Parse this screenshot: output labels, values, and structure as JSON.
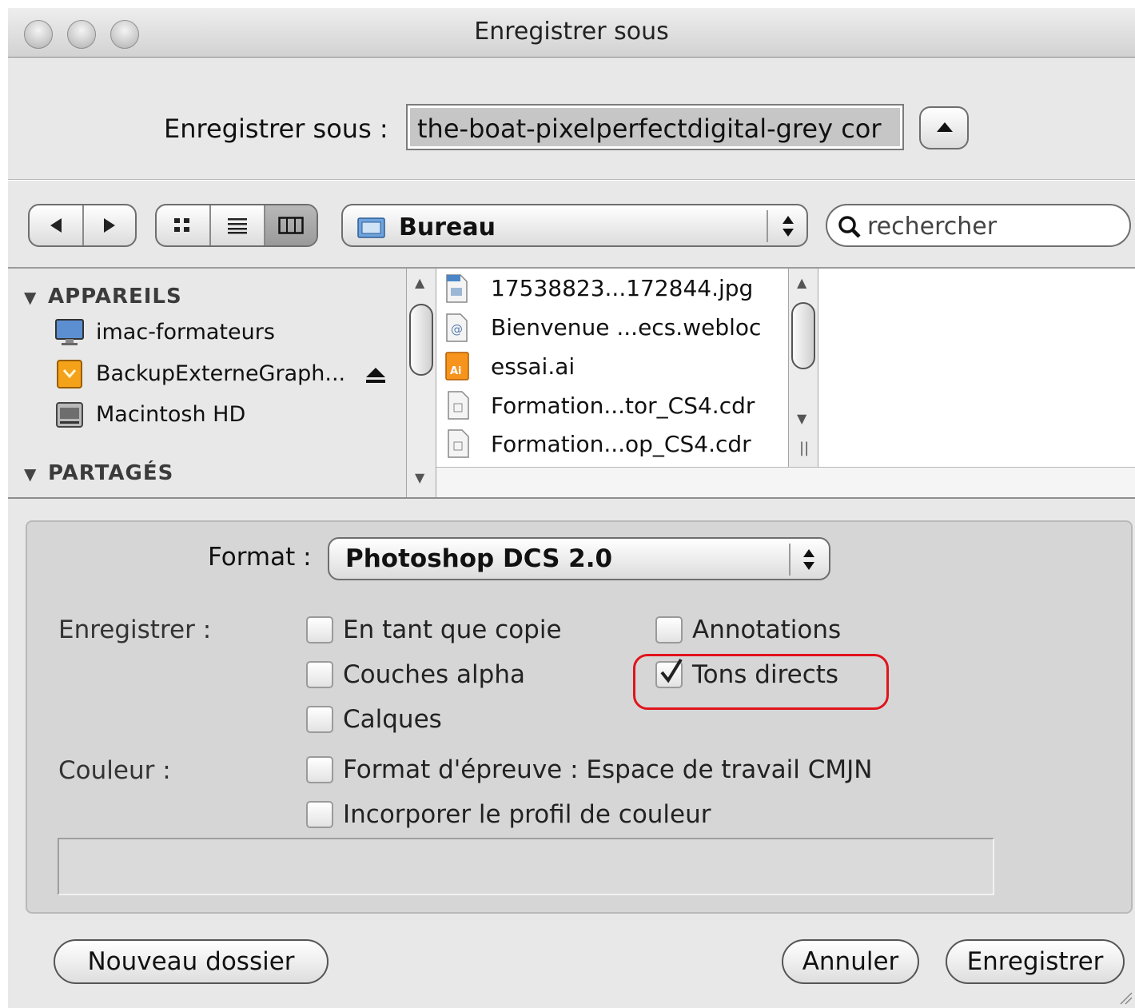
{
  "window": {
    "title": "Enregistrer sous"
  },
  "save_row": {
    "label": "Enregistrer sous :",
    "filename": "the-boat-pixelperfectdigital-grey cor"
  },
  "toolbar": {
    "location": "Bureau",
    "search_placeholder": "rechercher"
  },
  "sidebar": {
    "sections": [
      {
        "title": "APPAREILS",
        "items": [
          {
            "label": "imac-formateurs",
            "icon": "imac-icon"
          },
          {
            "label": "BackupExterneGraph...",
            "icon": "external-drive-icon",
            "ejectable": true
          },
          {
            "label": "Macintosh HD",
            "icon": "hard-drive-icon"
          }
        ]
      },
      {
        "title": "PARTAGÉS",
        "items": []
      }
    ]
  },
  "files": [
    {
      "name": "17538823...172844.jpg",
      "icon": "jpeg-file-icon"
    },
    {
      "name": "Bienvenue ...ecs.webloc",
      "icon": "webloc-file-icon"
    },
    {
      "name": "essai.ai",
      "icon": "illustrator-file-icon"
    },
    {
      "name": "Formation...tor_CS4.cdr",
      "icon": "document-icon"
    },
    {
      "name": "Formation...op_CS4.cdr",
      "icon": "document-icon"
    }
  ],
  "options": {
    "format_label": "Format :",
    "format_value": "Photoshop DCS 2.0",
    "save_label": "Enregistrer :",
    "color_label": "Couleur :",
    "checkboxes": {
      "copy": {
        "label": "En tant que copie",
        "checked": false
      },
      "annotations": {
        "label": "Annotations",
        "checked": false
      },
      "alpha": {
        "label": "Couches alpha",
        "checked": false
      },
      "spot": {
        "label": "Tons directs",
        "checked": true
      },
      "layers": {
        "label": "Calques",
        "checked": false
      },
      "proof": {
        "label": "Format d'épreuve : Espace de travail CMJN",
        "checked": false
      },
      "profile": {
        "label": "Incorporer le profil de couleur",
        "checked": false
      }
    }
  },
  "buttons": {
    "new_folder": "Nouveau dossier",
    "cancel": "Annuler",
    "save": "Enregistrer"
  },
  "colors": {
    "highlight": "#e0141c",
    "window_bg": "#e8e8e8"
  }
}
